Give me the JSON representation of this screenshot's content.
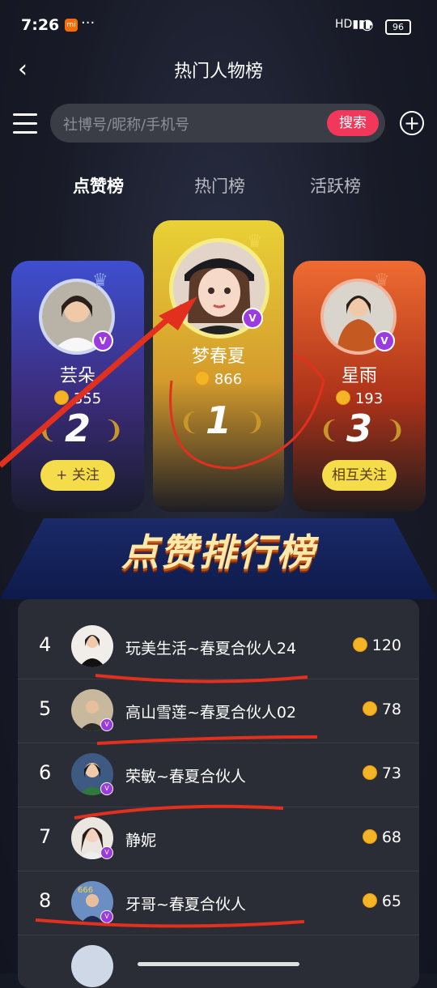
{
  "status_bar": {
    "time": "7:26",
    "network": "HD",
    "battery": "96"
  },
  "header": {
    "title": "热门人物榜"
  },
  "search": {
    "placeholder": "社博号/昵称/手机号",
    "button_label": "搜索"
  },
  "tabs": [
    {
      "label": "点赞榜",
      "active": true
    },
    {
      "label": "热门榜",
      "active": false
    },
    {
      "label": "活跃榜",
      "active": false
    }
  ],
  "podium": [
    {
      "rank": "2",
      "name": "芸朵",
      "score": "355",
      "button": "+ 关注"
    },
    {
      "rank": "1",
      "name": "梦春夏",
      "score": "866",
      "button": ""
    },
    {
      "rank": "3",
      "name": "星雨",
      "score": "193",
      "button": "相互关注"
    }
  ],
  "banner": "点赞排行榜",
  "list": [
    {
      "rank": "4",
      "name": "玩美生活~春夏合伙人24",
      "score": "120"
    },
    {
      "rank": "5",
      "name": "高山雪莲~春夏合伙人02",
      "score": "78"
    },
    {
      "rank": "6",
      "name": "荣敏~春夏合伙人",
      "score": "73"
    },
    {
      "rank": "7",
      "name": "静妮",
      "score": "68"
    },
    {
      "rank": "8",
      "name": "牙哥~春夏合伙人",
      "score": "65"
    }
  ],
  "colors": {
    "accent": "#f2385a",
    "gold": "#f5dc4a",
    "list_bg": "#2b2d36"
  }
}
